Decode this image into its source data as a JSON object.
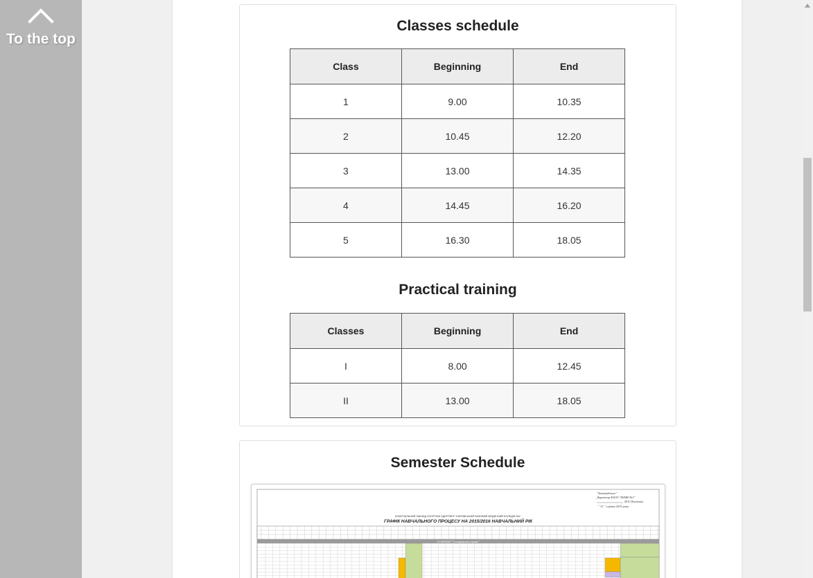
{
  "back_to_top": {
    "label": "To the top",
    "icon": "chevron-up-icon"
  },
  "classes_schedule": {
    "title": "Classes schedule",
    "columns": [
      "Class",
      "Beginning",
      "End"
    ],
    "rows": [
      [
        "1",
        "9.00",
        "10.35"
      ],
      [
        "2",
        "10.45",
        "12.20"
      ],
      [
        "3",
        "13.00",
        "14.35"
      ],
      [
        "4",
        "14.45",
        "16.20"
      ],
      [
        "5",
        "16.30",
        "18.05"
      ]
    ]
  },
  "practical_training": {
    "title": "Practical training",
    "columns": [
      "Classes",
      "Beginning",
      "End"
    ],
    "rows": [
      [
        "I",
        "8.00",
        "12.45"
      ],
      [
        "II",
        "13.00",
        "18.05"
      ]
    ]
  },
  "semester_schedule": {
    "title": "Semester Schedule",
    "image_heading": "ГРАФІК НАВЧАЛЬНОГО ПРОЦЕСУ НА 2015/2016 НАВЧАЛЬНИЙ РІК",
    "image_subheading": "КОМУНАЛЬНИЙ ЗАКЛАД ОХОРОНИ ЗДОРОВ'Я \"ХАРКІВСЬКИЙ БАЗОВИЙ МЕДИЧНИЙ КОЛЕДЖ №1\"",
    "image_approval_lines": [
      "\"Затверджую\"",
      "Директор КЗОЗ \"ХБМК №1\"",
      "М.Є.Панченко",
      "\" 31 \" серпня 2015 року"
    ],
    "image_specialty": "5.12010102 \"Сестринська справа\""
  },
  "colors": {
    "sidebar": "#b7b7b7",
    "table_header": "#ececec",
    "table_border": "#555555",
    "cell_orange": "#f5b800",
    "cell_green": "#c5dc9b",
    "cell_purple": "#c9b6e4"
  }
}
